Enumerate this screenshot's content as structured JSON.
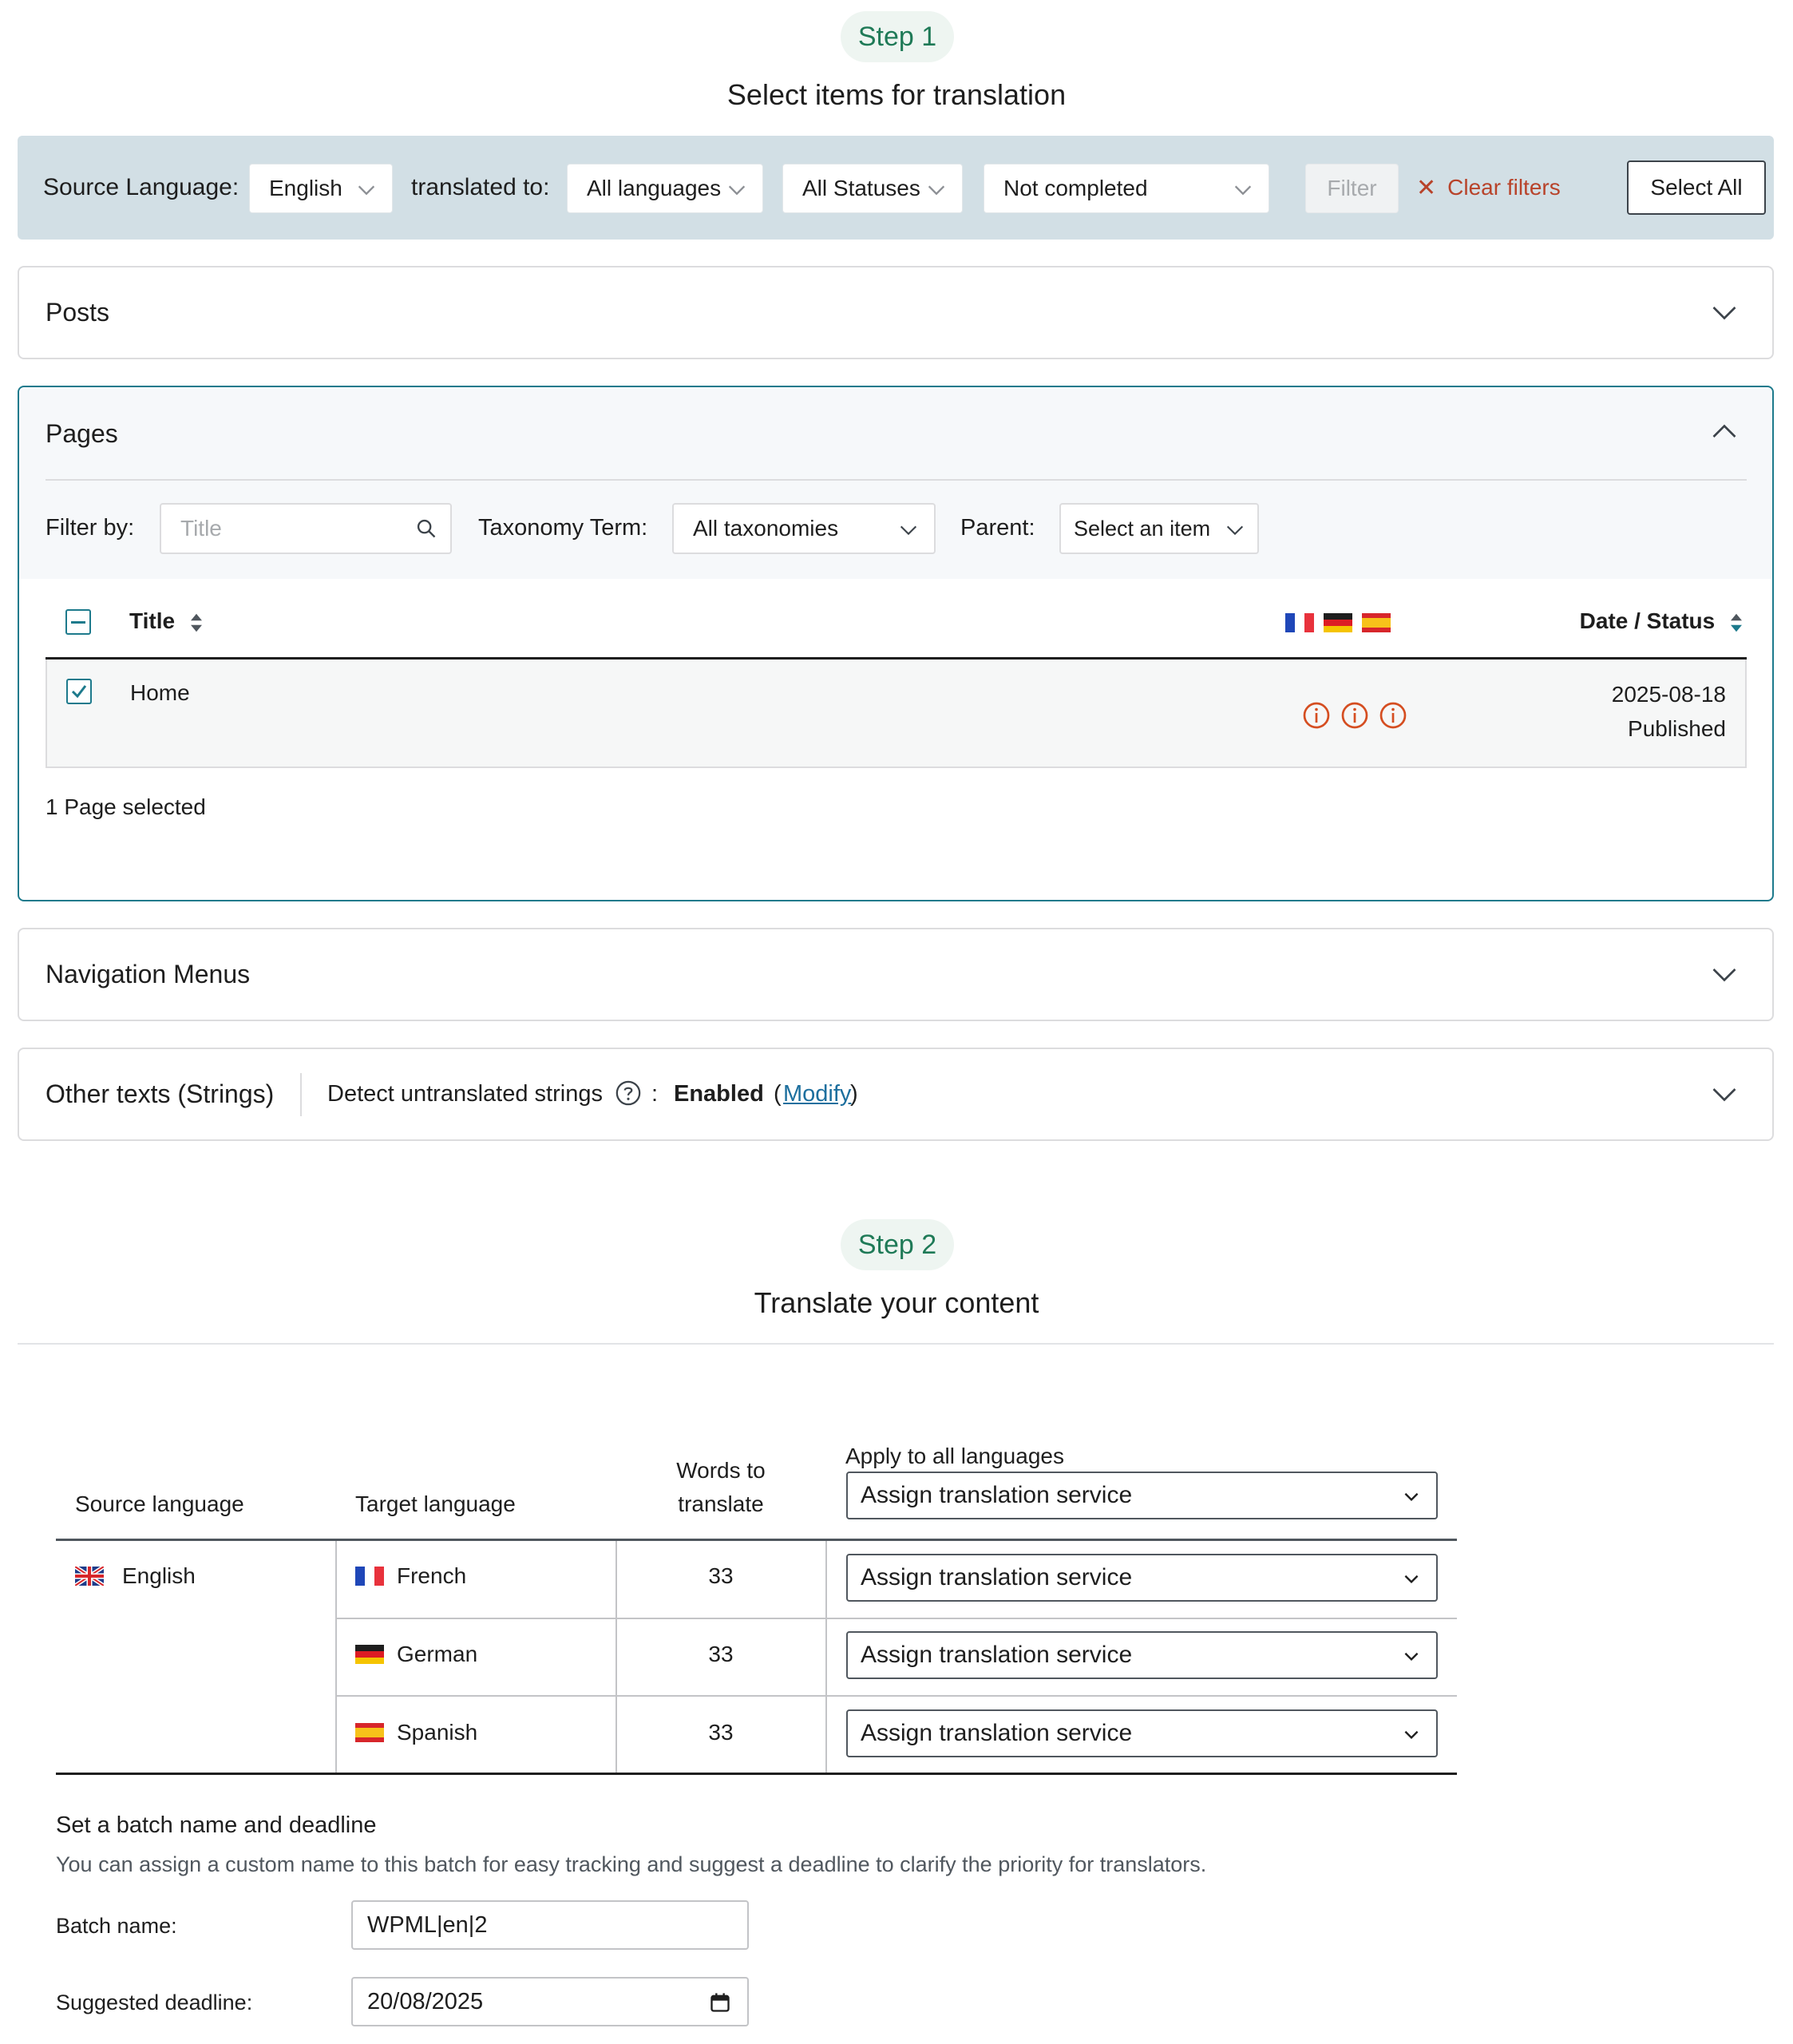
{
  "step1": {
    "pill": "Step 1",
    "title": "Select items for translation"
  },
  "filter_bar": {
    "source_language_label": "Source Language:",
    "source_language_value": "English",
    "translated_to_label": "translated to:",
    "languages_value": "All languages",
    "statuses_value": "All Statuses",
    "completion_value": "Not completed",
    "filter_button": "Filter",
    "clear_filters": "Clear filters",
    "select_all": "Select All"
  },
  "sections": {
    "posts": "Posts",
    "pages": "Pages",
    "navigation_menus": "Navigation Menus",
    "other_texts": "Other texts (Strings)"
  },
  "pages_panel": {
    "filter_by_label": "Filter by:",
    "title_placeholder": "Title",
    "taxonomy_label": "Taxonomy Term:",
    "taxonomy_value": "All taxonomies",
    "parent_label": "Parent:",
    "parent_value": "Select an item",
    "columns": {
      "title": "Title",
      "date_status": "Date / Status"
    },
    "rows": [
      {
        "title": "Home",
        "date": "2025-08-18",
        "status": "Published",
        "checked": true
      }
    ],
    "selection_summary": "1 Page selected"
  },
  "strings": {
    "detect_label": "Detect untranslated strings",
    "colon": ":",
    "status": "Enabled",
    "open_paren": "(",
    "modify_link": "Modify",
    "close_paren": ")"
  },
  "step2": {
    "pill": "Step 2",
    "title": "Translate your content"
  },
  "translation_table": {
    "headers": {
      "source_language": "Source language",
      "target_language": "Target language",
      "words_line1": "Words to",
      "words_line2": "translate",
      "apply_all": "Apply to all languages"
    },
    "apply_all_value": "Assign translation service",
    "source": "English",
    "targets": [
      {
        "language": "French",
        "words": "33",
        "service": "Assign translation service"
      },
      {
        "language": "German",
        "words": "33",
        "service": "Assign translation service"
      },
      {
        "language": "Spanish",
        "words": "33",
        "service": "Assign translation service"
      }
    ]
  },
  "batch": {
    "heading": "Set a batch name and deadline",
    "description": "You can assign a custom name to this batch for easy tracking and suggest a deadline to clarify the priority for translators.",
    "name_label": "Batch name:",
    "name_value": "WPML|en|2",
    "deadline_label": "Suggested deadline:",
    "deadline_value": "20/08/2025"
  },
  "colors": {
    "accent_teal": "#1d7a8c",
    "step_green": "#1f7a57",
    "clear_red": "#b8432a",
    "filter_bar_bg": "#d2dfe5",
    "warning_orange": "#d54e21"
  }
}
